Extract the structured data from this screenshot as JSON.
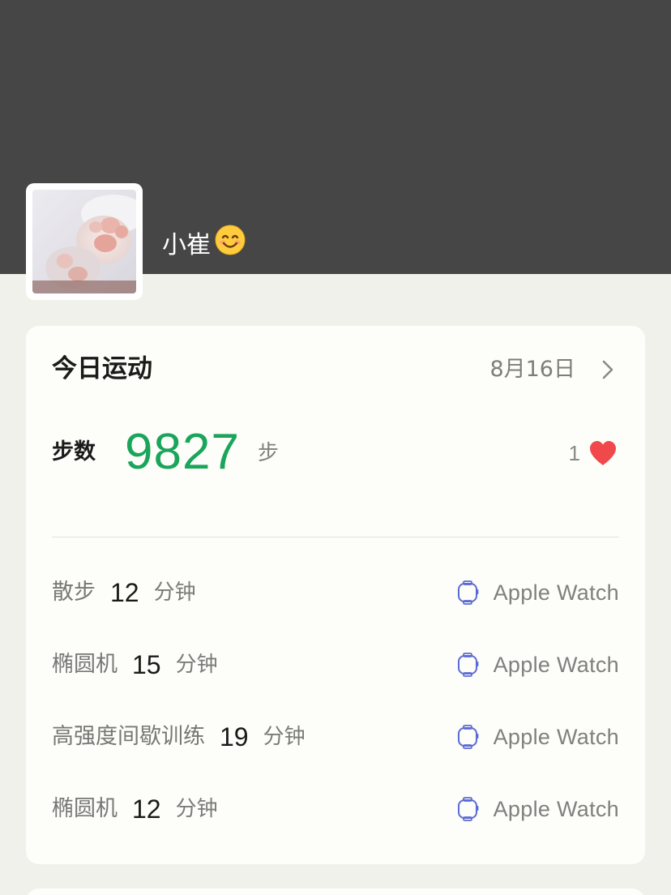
{
  "profile": {
    "name": "小崔",
    "emoji": "😊"
  },
  "today_card": {
    "title": "今日运动",
    "date": "8月16日",
    "steps_label": "步数",
    "steps_value": "9827",
    "steps_unit": "步",
    "like_count": "1",
    "workouts": [
      {
        "name": "散步",
        "minutes": "12",
        "unit": "分钟",
        "device": "Apple Watch"
      },
      {
        "name": "椭圆机",
        "minutes": "15",
        "unit": "分钟",
        "device": "Apple Watch"
      },
      {
        "name": "高强度间歇训练",
        "minutes": "19",
        "unit": "分钟",
        "device": "Apple Watch"
      },
      {
        "name": "椭圆机",
        "minutes": "12",
        "unit": "分钟",
        "device": "Apple Watch"
      }
    ]
  },
  "colors": {
    "cover": "#464646",
    "steps_accent": "#19a55a",
    "heart": "#f0484b",
    "watch_icon": "#5b6bd6"
  },
  "icons": {
    "chevron": "chevron-right-icon",
    "heart": "heart-icon",
    "watch": "apple-watch-icon"
  }
}
